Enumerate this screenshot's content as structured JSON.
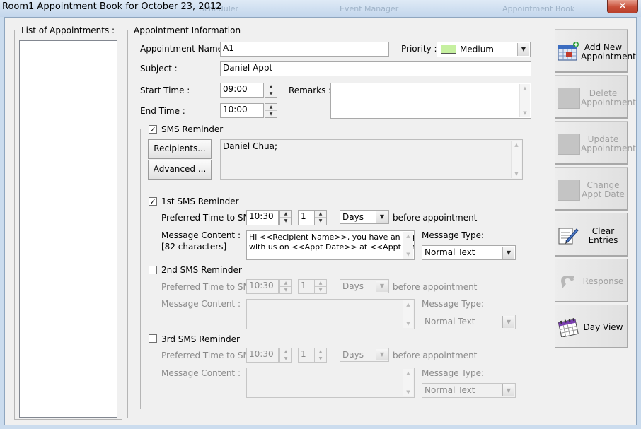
{
  "window": {
    "title": "Room1 Appointment Book for October 23, 2012",
    "close_glyph": "✕",
    "background_tabs": [
      "Scheduler",
      "Event Manager",
      "Appointment Book"
    ]
  },
  "list_panel": {
    "label": "List of Appointments :"
  },
  "appointment": {
    "group_label": "Appointment Information",
    "name_label": "Appointment Name :",
    "name_value": "A1",
    "priority_label": "Priority :",
    "priority_value": "Medium",
    "priority_color": "#c6f0a0",
    "subject_label": "Subject :",
    "subject_value": "Daniel Appt",
    "start_label": "Start Time :",
    "start_value": "09:00",
    "end_label": "End Time :",
    "end_value": "10:00",
    "remarks_label": "Remarks :",
    "remarks_value": ""
  },
  "sms": {
    "label": "SMS Reminder",
    "checked": true,
    "recipients_button": "Recipients...",
    "advanced_button": "Advanced ...",
    "recipients_value": "Daniel Chua;",
    "reminder1": {
      "label": "1st SMS Reminder",
      "checked": true,
      "time_label": "Preferred Time to SMS:",
      "time_value": "10:30",
      "count_value": "1",
      "unit_value": "Days",
      "suffix": "before appointment",
      "content_label": "Message Content :",
      "char_count": "[82 characters]",
      "content_line1": "Hi <<Recipient Name>>, you have an appt",
      "content_line2": "with us on <<Appt Date>> at <<Appt Time>>.",
      "type_label": "Message Type:",
      "type_value": "Normal Text"
    },
    "reminder2": {
      "label": "2nd SMS Reminder",
      "checked": false,
      "time_label": "Preferred Time to SMS:",
      "time_value": "10:30",
      "count_value": "1",
      "unit_value": "Days",
      "suffix": "before appointment",
      "content_label": "Message Content :",
      "type_label": "Message Type:",
      "type_value": "Normal Text"
    },
    "reminder3": {
      "label": "3rd SMS Reminder",
      "checked": false,
      "time_label": "Preferred Time to SMS:",
      "time_value": "10:30",
      "count_value": "1",
      "unit_value": "Days",
      "suffix": "before appointment",
      "content_label": "Message Content :",
      "type_label": "Message Type:",
      "type_value": "Normal Text"
    }
  },
  "actions": {
    "add": {
      "line1": "Add New",
      "line2": "Appointment"
    },
    "delete": {
      "line1": "Delete",
      "line2": "Appointment"
    },
    "update": {
      "line1": "Update",
      "line2": "Appointment"
    },
    "change": {
      "line1": "Change",
      "line2": "Appt Date"
    },
    "clear": {
      "line1": "Clear",
      "line2": "Entries"
    },
    "response": {
      "line1": "Response"
    },
    "dayview": {
      "line1": "Day View"
    }
  },
  "glyphs": {
    "check": "✓",
    "up": "▲",
    "down": "▼"
  }
}
